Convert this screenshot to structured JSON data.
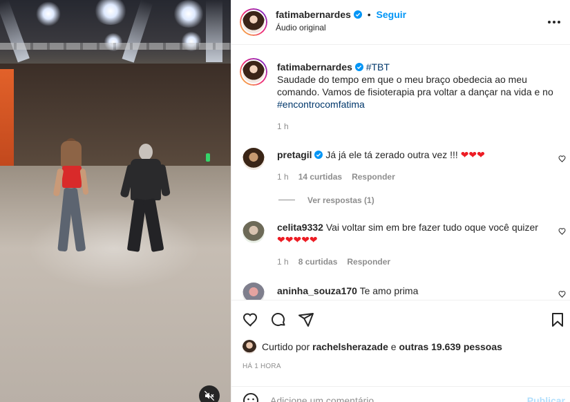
{
  "video": {
    "muted": true,
    "mute_icon": "speaker-muted-icon"
  },
  "header": {
    "username": "fatimabernardes",
    "separator": "•",
    "follow_label": "Seguir",
    "audio_label": "Áudio original",
    "more_icon": "more-horizontal-icon"
  },
  "caption": {
    "username": "fatimabernardes",
    "tag": "#TBT",
    "text": "Saudade do tempo em que o meu braço obedecia ao meu comando. Vamos de fisioterapia pra voltar a dançar na vida e no",
    "hashtag": "#encontrocomfatima",
    "time": "1 h"
  },
  "comments": [
    {
      "username": "pretagil",
      "verified": true,
      "text": "Já já ele tá zerado outra vez !!! ",
      "hearts": "❤❤❤",
      "time": "1 h",
      "likes": "14 curtidas",
      "reply": "Responder",
      "view_replies": "Ver respostas (1)"
    },
    {
      "username": "celita9332",
      "verified": false,
      "text": "Vai voltar sim em bre fazer tudo oque você quizer",
      "hearts": "❤❤❤❤❤",
      "time": "1 h",
      "likes": "8 curtidas",
      "reply": "Responder"
    },
    {
      "username": "aninha_souza170",
      "verified": false,
      "text": "Te amo prima"
    }
  ],
  "actions": {
    "like_icon": "heart-icon",
    "comment_icon": "comment-icon",
    "share_icon": "share-icon",
    "save_icon": "bookmark-icon"
  },
  "likes": {
    "prefix": "Curtido por",
    "user": "rachelsherazade",
    "middle": "e",
    "others": "outras 19.639 pessoas"
  },
  "timestamp": "HÁ 1 HORA",
  "add_comment": {
    "emoji_icon": "emoji-icon",
    "placeholder": "Adicione um comentário...",
    "publish_label": "Publicar"
  },
  "colors": {
    "accent": "#0095f6",
    "verified": "#0095f6",
    "heart": "#ed1c24",
    "hashtag": "#00376b"
  }
}
